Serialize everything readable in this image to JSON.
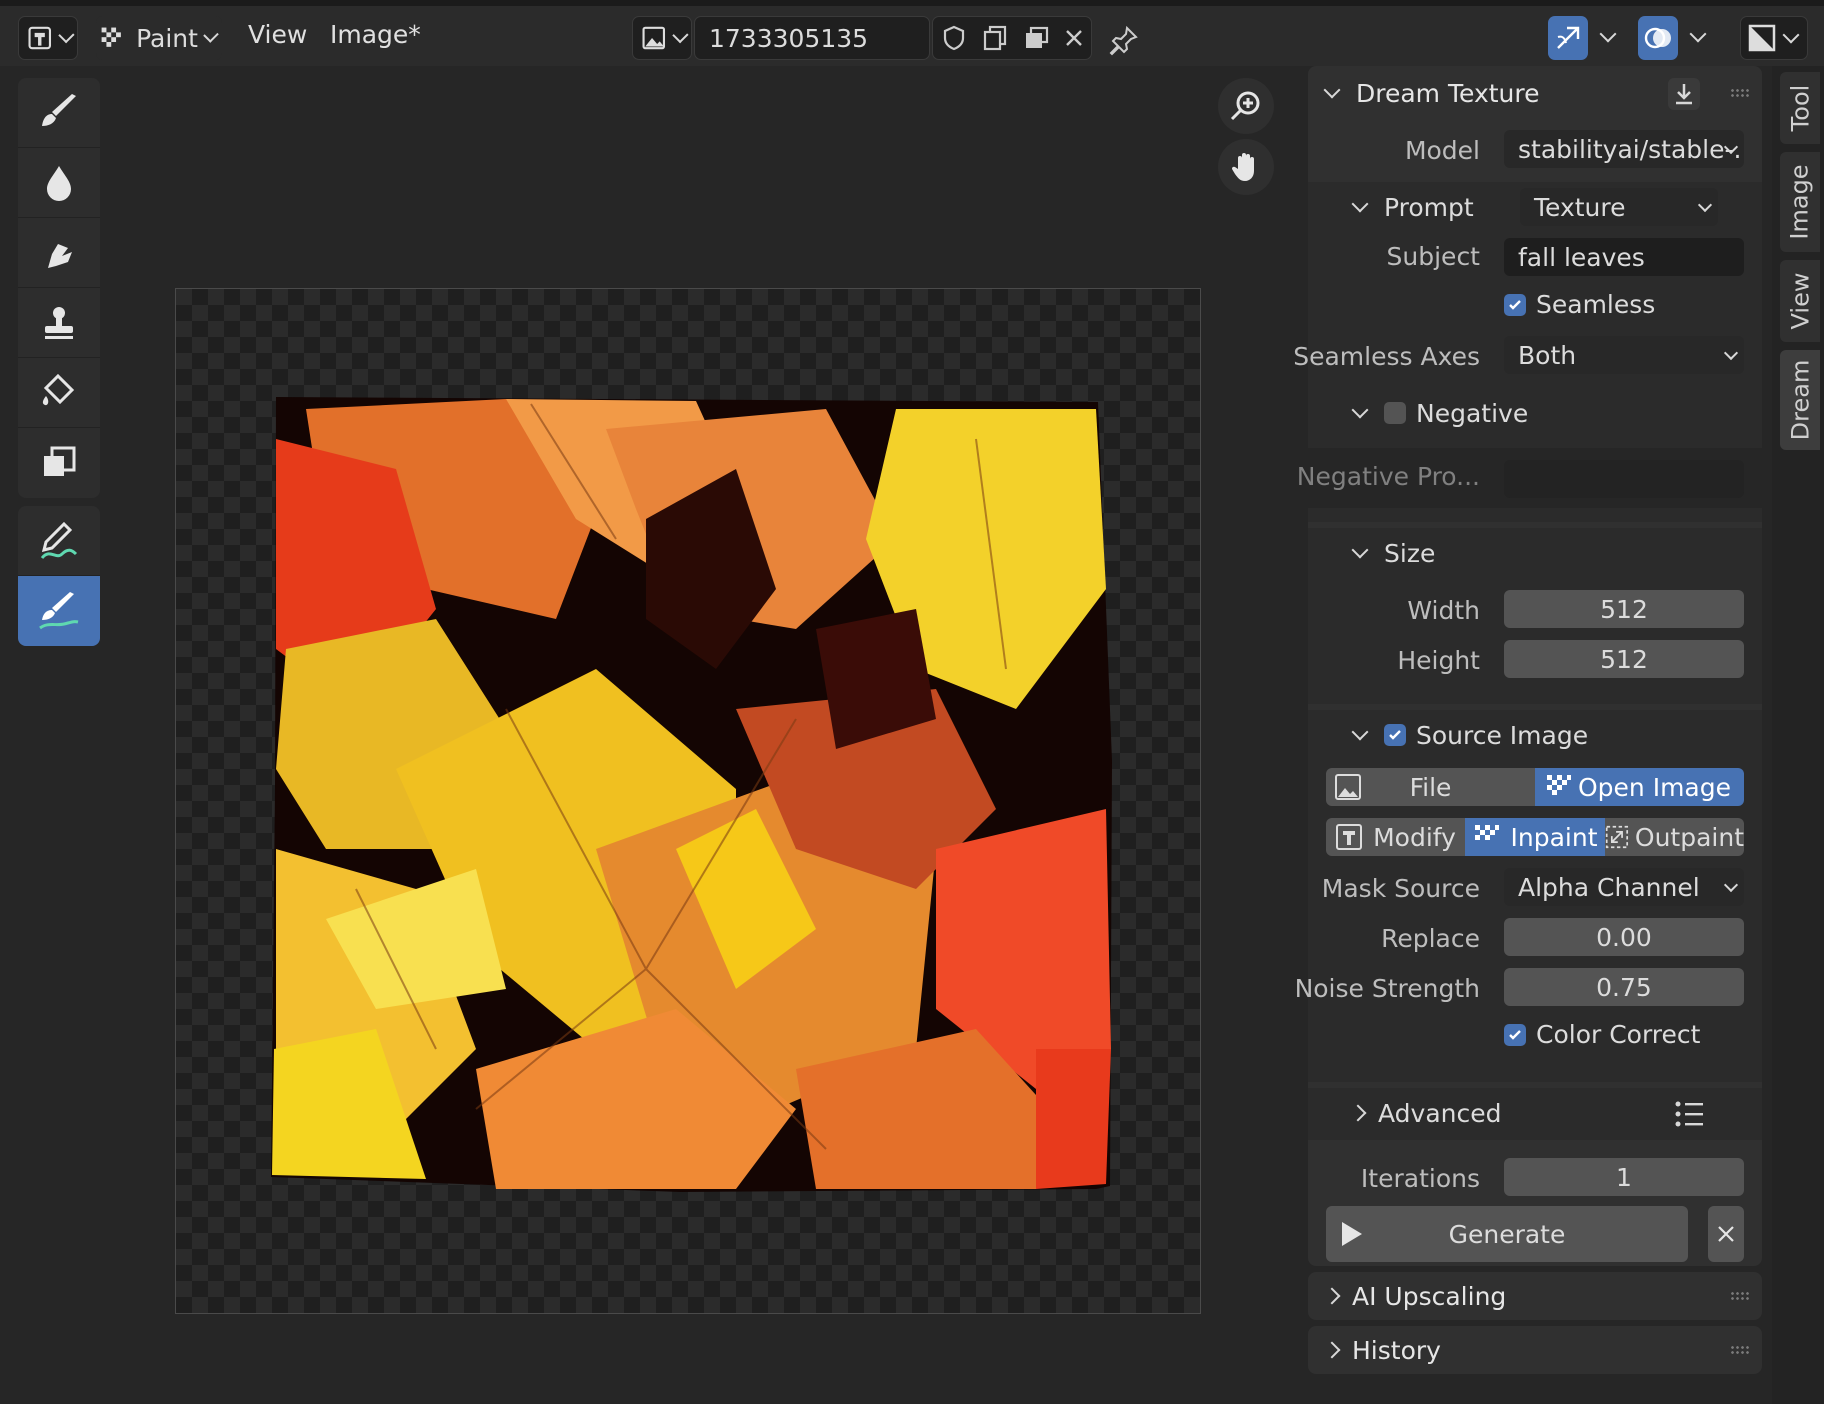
{
  "header": {
    "mode_label": "Paint",
    "menu_view": "View",
    "menu_image": "Image*",
    "image_name": "1733305135"
  },
  "canvas": {
    "image_subject": "fall leaves texture"
  },
  "panel": {
    "title": "Dream Texture",
    "model_label": "Model",
    "model_value": "stabilityai/stable-...",
    "prompt_label": "Prompt",
    "prompt_value": "Texture",
    "subject_label": "Subject",
    "subject_value": "fall leaves",
    "seamless_label": "Seamless",
    "seamless_checked": true,
    "seamless_axes_label": "Seamless Axes",
    "seamless_axes_value": "Both",
    "negative_label": "Negative",
    "negative_checked": false,
    "negative_prompt_label": "Negative Pro...",
    "negative_prompt_value": "",
    "size_label": "Size",
    "width_label": "Width",
    "width_value": "512",
    "height_label": "Height",
    "height_value": "512",
    "source_image_label": "Source Image",
    "source_image_checked": true,
    "source_file": "File",
    "source_open_image": "Open Image",
    "action_modify": "Modify",
    "action_inpaint": "Inpaint",
    "action_outpaint": "Outpaint",
    "mask_source_label": "Mask Source",
    "mask_source_value": "Alpha Channel",
    "replace_label": "Replace",
    "replace_value": "0.00",
    "noise_strength_label": "Noise Strength",
    "noise_strength_value": "0.75",
    "color_correct_label": "Color Correct",
    "color_correct_checked": true,
    "advanced_label": "Advanced",
    "iterations_label": "Iterations",
    "iterations_value": "1",
    "generate_label": "Generate",
    "ai_upscaling_label": "AI Upscaling",
    "history_label": "History"
  },
  "tabs": [
    "Tool",
    "Image",
    "View",
    "Dream"
  ],
  "colors": {
    "accent": "#4772b3",
    "background": "#262626",
    "panel": "#303030"
  }
}
